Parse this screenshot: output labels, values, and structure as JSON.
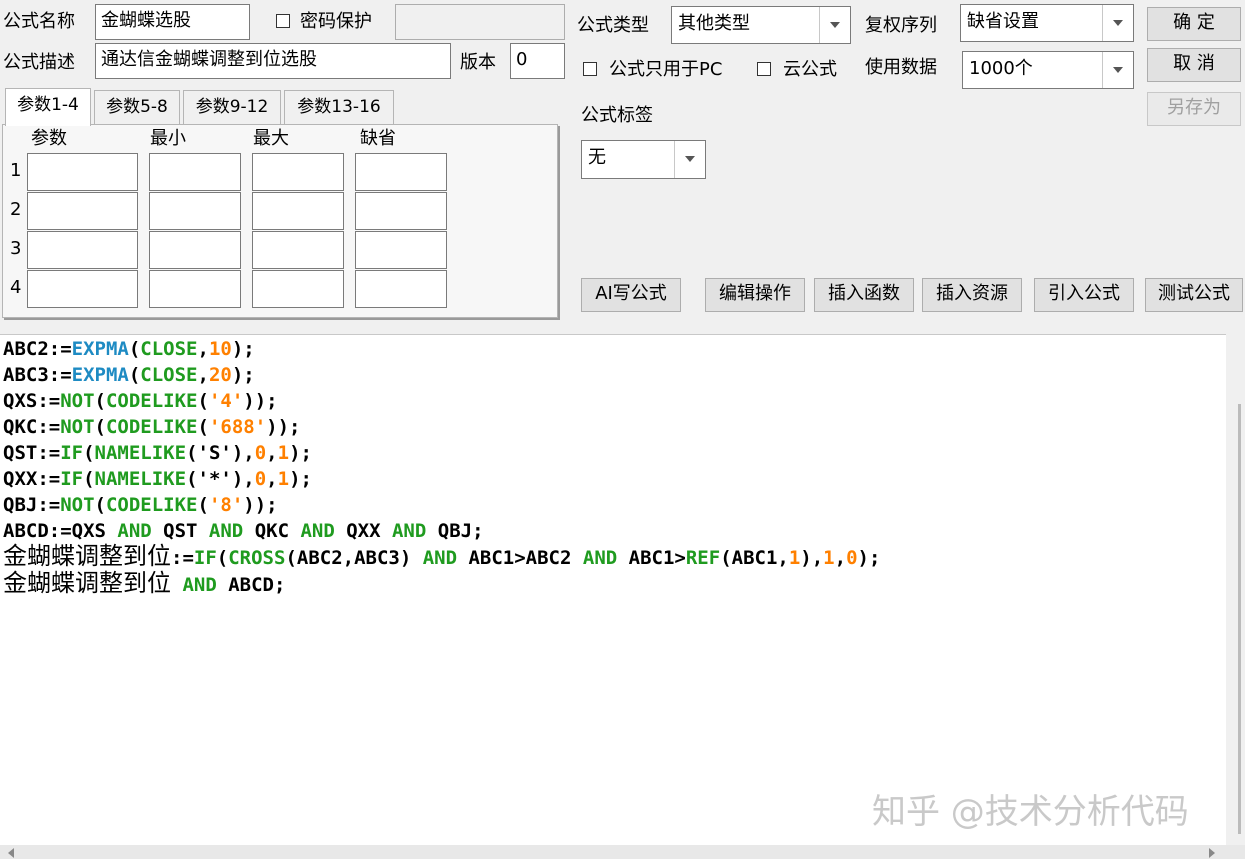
{
  "header": {
    "name_label": "公式名称",
    "name_value": "金蝴蝶选股",
    "password_label": "密码保护",
    "password_value": "",
    "desc_label": "公式描述",
    "desc_value": "通达信金蝴蝶调整到位选股",
    "version_label": "版本",
    "version_value": "0",
    "type_label": "公式类型",
    "type_value": "其他类型",
    "pc_only_label": "公式只用于PC",
    "cloud_label": "云公式",
    "fuquan_label": "复权序列",
    "fuquan_value": "缺省设置",
    "data_label": "使用数据",
    "data_value": "1000个",
    "tag_label": "公式标签",
    "tag_value": "无"
  },
  "buttons": {
    "ok": "确 定",
    "cancel": "取 消",
    "save_as": "另存为",
    "ai": "AI写公式",
    "edit": "编辑操作",
    "insert_func": "插入函数",
    "insert_res": "插入资源",
    "import": "引入公式",
    "test": "测试公式"
  },
  "tabs": [
    "参数1-4",
    "参数5-8",
    "参数9-12",
    "参数13-16"
  ],
  "params": {
    "headers": [
      "参数",
      "最小",
      "最大",
      "缺省"
    ],
    "rows": [
      "1",
      "2",
      "3",
      "4"
    ]
  },
  "code": {
    "l1": [
      "ABC2:=",
      "EXPMA",
      "(",
      "CLOSE",
      ",",
      "10",
      ");"
    ],
    "l2": [
      "ABC3:=",
      "EXPMA",
      "(",
      "CLOSE",
      ",",
      "20",
      ");"
    ],
    "l3": [
      "QXS:=",
      "NOT",
      "(",
      "CODELIKE",
      "(",
      "'4'",
      "));"
    ],
    "l4": [
      "QKC:=",
      "NOT",
      "(",
      "CODELIKE",
      "(",
      "'688'",
      "));"
    ],
    "l5": [
      "QST:=",
      "IF",
      "(",
      "NAMELIKE",
      "('S'),",
      "0",
      ",",
      "1",
      ");"
    ],
    "l6": [
      "QXX:=",
      "IF",
      "(",
      "NAMELIKE",
      "('*'),",
      "0",
      ",",
      "1",
      ");"
    ],
    "l7": [
      "QBJ:=",
      "NOT",
      "(",
      "CODELIKE",
      "(",
      "'8'",
      "));"
    ],
    "l8": [
      "ABCD:=QXS ",
      "AND",
      " QST ",
      "AND",
      " QKC ",
      "AND",
      " QXX ",
      "AND",
      " QBJ;"
    ],
    "l9": [
      "金蝴蝶调整到位",
      ":=",
      "IF",
      "(",
      "CROSS",
      "(ABC2,ABC3) ",
      "AND",
      " ABC1>ABC2 ",
      "AND",
      " ABC1>",
      "REF",
      "(ABC1,",
      "1",
      "),",
      "1",
      ",",
      "0",
      ");"
    ],
    "l10": [
      "金蝴蝶调整到位",
      " ",
      "AND",
      " ABCD;"
    ]
  },
  "watermark": "知乎 @技术分析代码"
}
